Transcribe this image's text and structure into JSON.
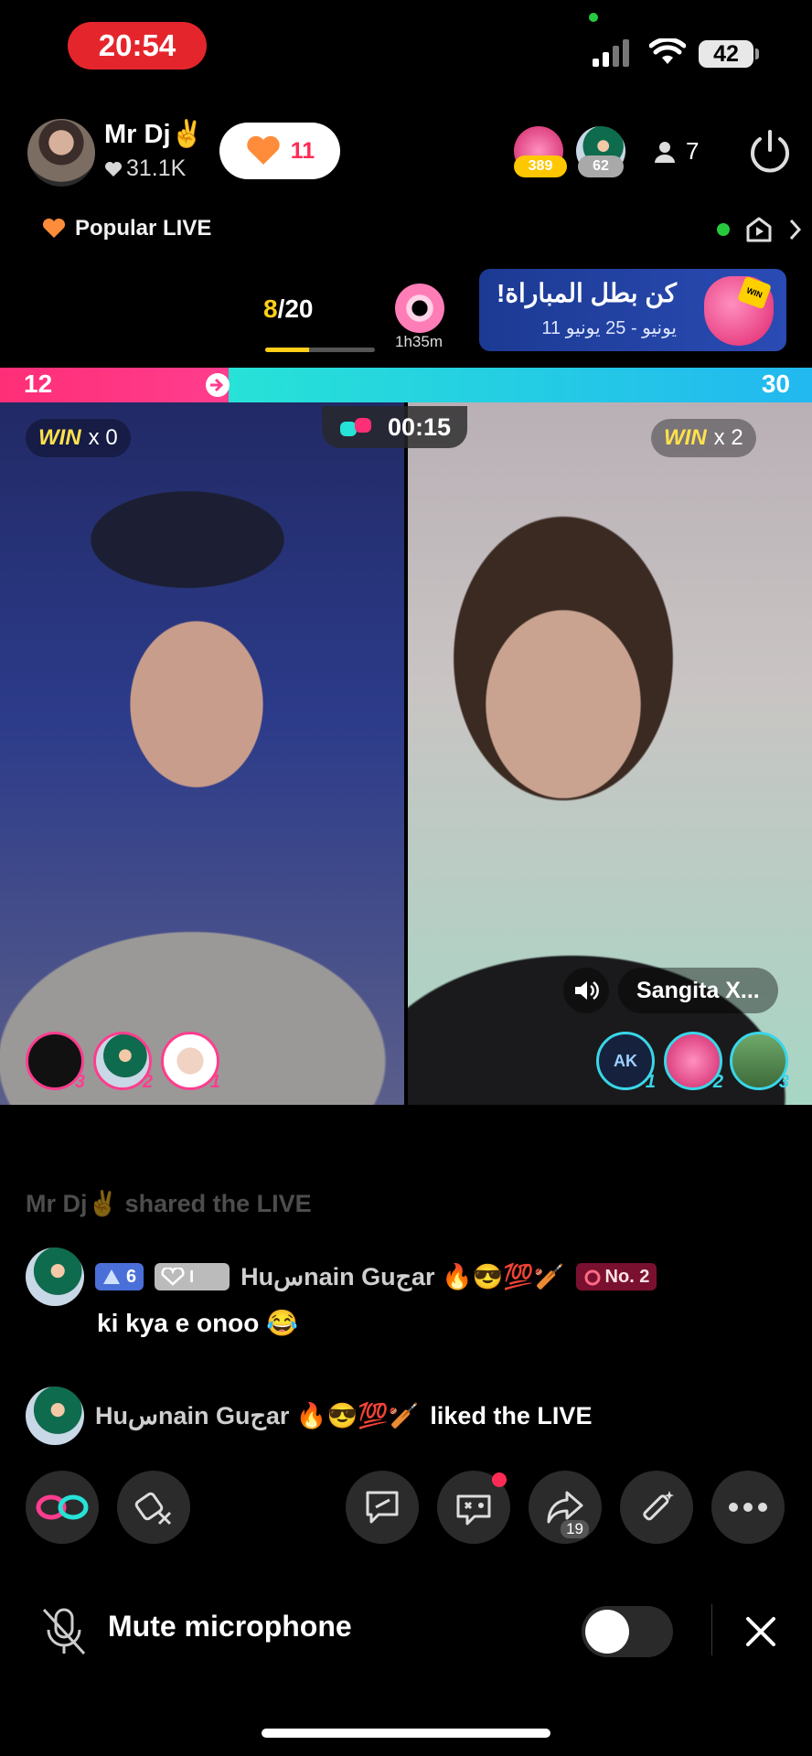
{
  "status_bar": {
    "time": "20:54",
    "battery": "42"
  },
  "host": {
    "name": "Mr Dj✌️",
    "likes": "31.1K",
    "follow_count": "11"
  },
  "top_viewers": [
    {
      "rank_value": "389"
    },
    {
      "rank_value": "62"
    }
  ],
  "viewer_count": "7",
  "popular_label": "Popular LIVE",
  "quest": {
    "current": "8",
    "total": "/20",
    "progress": 0.4,
    "timer": "1h35m"
  },
  "banner": {
    "title": "كن بطل المباراة!",
    "subtitle": "يونيو - 25 يونيو 11",
    "gift_tag": "WIN"
  },
  "battle": {
    "left_score": "12",
    "right_score": "30",
    "timer": "00:15",
    "left_win": {
      "label": "WIN",
      "count": "x 0"
    },
    "right_win": {
      "label": "WIN",
      "count": "x 2"
    },
    "opponent_name": "Sangita X...",
    "left_gifters": [
      "3",
      "2",
      "1"
    ],
    "right_gifters": [
      "1",
      "2",
      "3"
    ],
    "right_gifter_initials": "AK"
  },
  "chat": {
    "faded_line": "Mr Dj✌️ shared the LIVE",
    "message1": {
      "level": "6",
      "fan_level": "I",
      "username": "Huسnain Guجar 🔥😎💯🏏",
      "rank_badge": "No. 2",
      "text": "ki kya e onoo 😂"
    },
    "message2": {
      "username": "Huسnain Guجar 🔥😎💯🏏",
      "action": "liked the LIVE"
    }
  },
  "toolbar": {
    "share_count": "19"
  },
  "mute": {
    "label": "Mute microphone"
  },
  "colors": {
    "pink": "#ff2e77",
    "cyan": "#27e2d7",
    "tiktok_red": "#fe2c55",
    "gold": "#ffe14d"
  }
}
